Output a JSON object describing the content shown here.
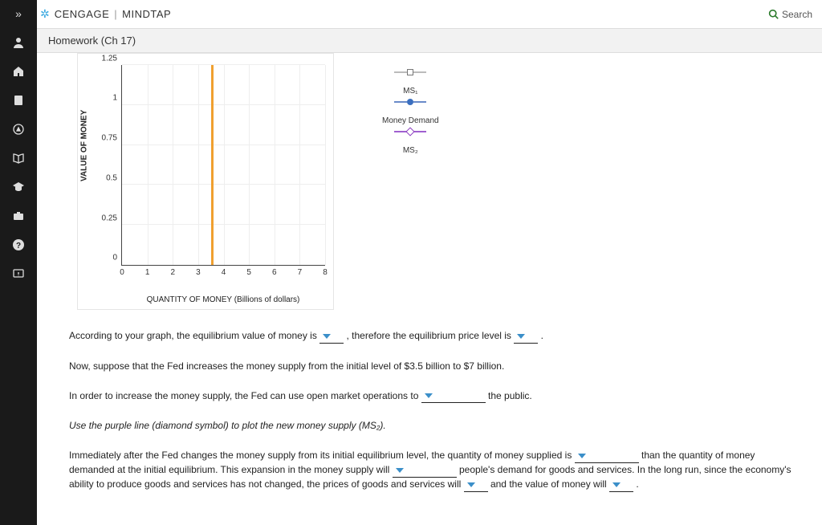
{
  "brand": {
    "cengage": "CENGAGE",
    "mindtap": "MINDTAP",
    "divider": "|"
  },
  "search": {
    "icon": "⌕",
    "label": "Search"
  },
  "sidebar_icons": [
    "expand",
    "user",
    "home",
    "book",
    "compass",
    "open-book",
    "grad-cap",
    "briefcase",
    "help",
    "feedback"
  ],
  "subheader": {
    "title": "Homework (Ch 17)"
  },
  "chart_data": {
    "type": "line",
    "xlabel": "QUANTITY OF MONEY (Billions of dollars)",
    "ylabel": "VALUE OF MONEY",
    "xticks": [
      0,
      1,
      2,
      3,
      4,
      5,
      6,
      7,
      8
    ],
    "yticks": [
      0,
      0.25,
      0.5,
      0.75,
      1.0,
      1.25
    ],
    "xlim": [
      0,
      8
    ],
    "ylim": [
      0,
      1.25
    ],
    "series": [
      {
        "name": "MS1",
        "type": "vertical",
        "x": 3.5,
        "color": "#f0a030"
      }
    ],
    "legends": [
      {
        "label": "",
        "symbol": "square",
        "line": "#bbb"
      },
      {
        "label": "MS₁",
        "symbol": "circle",
        "line": "#6a8bc9"
      },
      {
        "label": "Money Demand",
        "symbol": "",
        "line": ""
      },
      {
        "label": "",
        "symbol": "diamond",
        "line": "#a060d0"
      },
      {
        "label": "MS₂",
        "symbol": "",
        "line": ""
      }
    ]
  },
  "text": {
    "p1a": "According to your graph, the equilibrium value of money is ",
    "p1b": " , therefore the equilibrium price level is ",
    "p1c": " .",
    "p2": "Now, suppose that the Fed increases the money supply from the initial level of $3.5 billion to $7 billion.",
    "p3a": "In order to increase the money supply, the Fed can use open market operations to ",
    "p3b": " the public.",
    "p4": "Use the purple line (diamond symbol) to plot the new money supply (MS₂).",
    "p5a": "Immediately after the Fed changes the money supply from its initial equilibrium level, the quantity of money supplied is ",
    "p5b": " than the quantity of money demanded at the initial equilibrium. This expansion in the money supply will ",
    "p5c": " people's demand for goods and services. In the long run, since the economy's ability to produce goods and services has not changed, the prices of goods and services will ",
    "p5d": " and the value of money will ",
    "p5e": " ."
  }
}
